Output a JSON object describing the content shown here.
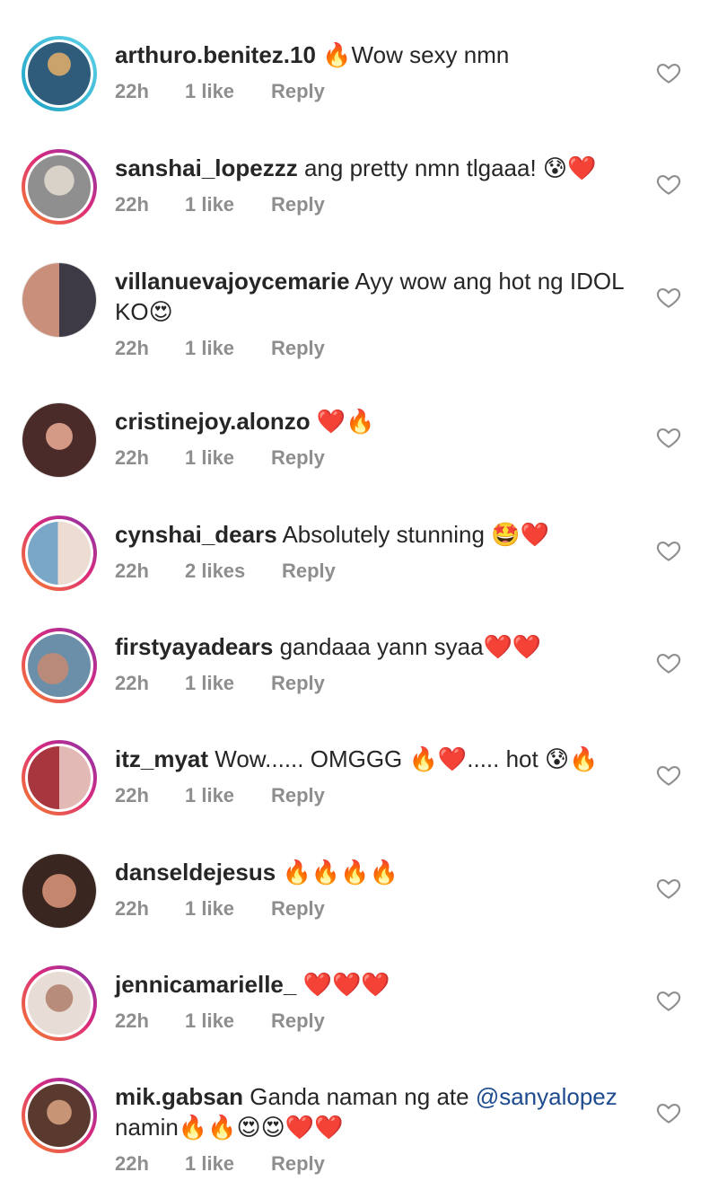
{
  "comments": [
    {
      "username": "arthuro.benitez.10",
      "text": "🔥Wow sexy nmn",
      "time": "22h",
      "likes": "1 like",
      "reply": "Reply",
      "avatar_style": "ring-blue",
      "avatar_colors": [
        "#2f5c7a",
        "#c9a36b"
      ]
    },
    {
      "username": "sanshai_lopezzz",
      "text": "ang pretty nmn tlgaaa! 😰❤️",
      "time": "22h",
      "likes": "1 like",
      "reply": "Reply",
      "avatar_style": "ring",
      "avatar_colors": [
        "#8f8f8f",
        "#d9d2c8"
      ]
    },
    {
      "username": "villanuevajoycemarie",
      "text": "Ayy wow ang hot ng IDOL KO😍",
      "time": "22h",
      "likes": "1 like",
      "reply": "Reply",
      "avatar_style": "plain",
      "avatar_colors": [
        "#c98f7a",
        "#3d3a45"
      ]
    },
    {
      "username": "cristinejoy.alonzo",
      "text": "❤️🔥",
      "time": "22h",
      "likes": "1 like",
      "reply": "Reply",
      "avatar_style": "plain",
      "avatar_colors": [
        "#4a2b2a",
        "#d59a86"
      ]
    },
    {
      "username": "cynshai_dears",
      "text": "Absolutely stunning 🤩❤️",
      "time": "22h",
      "likes": "2 likes",
      "reply": "Reply",
      "avatar_style": "ring",
      "avatar_colors": [
        "#7aa6c7",
        "#ecdcd2"
      ]
    },
    {
      "username": "firstyayadears",
      "text": "gandaaa yann syaa❤️❤️",
      "time": "22h",
      "likes": "1 like",
      "reply": "Reply",
      "avatar_style": "ring",
      "avatar_colors": [
        "#6b8fa8",
        "#b98a7a"
      ]
    },
    {
      "username": "itz_myat",
      "text": "Wow...... OMGGG 🔥❤️..... hot 😰🔥",
      "time": "22h",
      "likes": "1 like",
      "reply": "Reply",
      "avatar_style": "ring",
      "avatar_colors": [
        "#a8363e",
        "#e2b9b4"
      ]
    },
    {
      "username": "danseldejesus",
      "text": "🔥🔥🔥🔥",
      "time": "22h",
      "likes": "1 like",
      "reply": "Reply",
      "avatar_style": "plain",
      "avatar_colors": [
        "#c4876d",
        "#3a2620"
      ]
    },
    {
      "username": "jennicamarielle_",
      "text": "❤️❤️❤️",
      "time": "22h",
      "likes": "1 like",
      "reply": "Reply",
      "avatar_style": "ring",
      "avatar_colors": [
        "#b88c7a",
        "#e8dcd6"
      ]
    },
    {
      "username": "mik.gabsan",
      "text": "Ganda naman ng ate ",
      "mention": "@sanyalopez",
      "text_after": " namin🔥🔥😍😍❤️❤️",
      "time": "22h",
      "likes": "1 like",
      "reply": "Reply",
      "avatar_style": "ring",
      "avatar_colors": [
        "#5a3a2e",
        "#c89476"
      ]
    }
  ],
  "colors": {
    "username": "#262626",
    "meta": "#8e8e8e",
    "mention": "#1e4b8f",
    "heart_outline": "#8e8e8e"
  },
  "icons": {
    "like": "heart-outline-icon"
  }
}
